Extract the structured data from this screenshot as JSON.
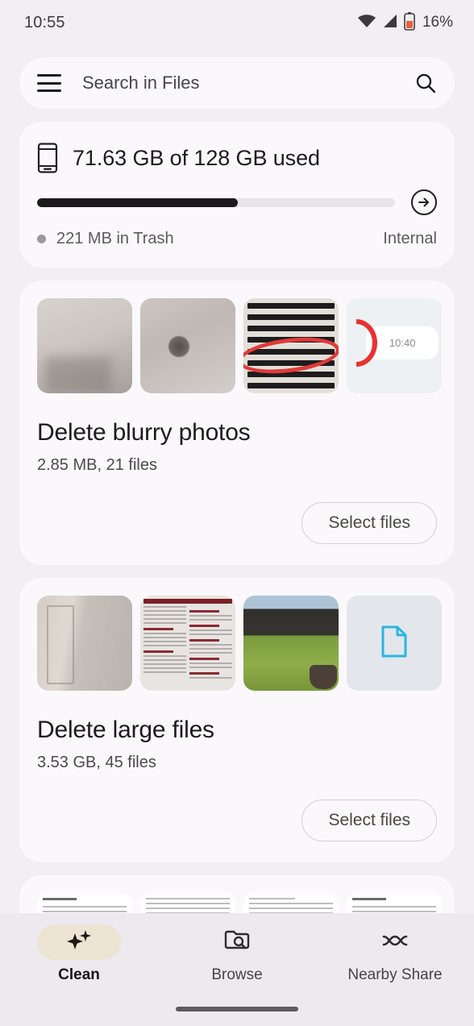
{
  "status_bar": {
    "time": "10:55",
    "battery_percent": "16%",
    "icons": [
      "wifi-icon",
      "cellular-signal-icon",
      "battery-low-icon"
    ]
  },
  "search": {
    "menu_icon": "hamburger-menu-icon",
    "placeholder": "Search in Files",
    "value": "",
    "search_icon": "search-icon"
  },
  "storage": {
    "device_icon": "phone-storage-icon",
    "title": "71.63 GB of 128 GB used",
    "used_gb": 71.63,
    "total_gb": 128,
    "used_percent": 56,
    "trash_label": "221 MB in Trash",
    "location_label": "Internal",
    "arrow_icon": "arrow-forward-circle-icon"
  },
  "suggestions": [
    {
      "id": "delete-blurry-photos",
      "title": "Delete blurry photos",
      "subtitle": "2.85 MB, 21 files",
      "action_label": "Select files",
      "thumbnails": [
        {
          "kind": "photo",
          "art": "art-sink-a",
          "alt": "blurry bathroom surface"
        },
        {
          "kind": "photo",
          "art": "art-sink-b",
          "alt": "blurry sink drain"
        },
        {
          "kind": "photo",
          "art": "art-news",
          "alt": "newspaper clipping with red circle annotation",
          "lines": [
            "ason of mists and",
            "y fruitfulness is",
            "us. For some a sad",
            "ith the daylight",
            "diminishing and",
            "g bills soaring.",
            "r many youngster",
            "ime for excitemen"
          ]
        },
        {
          "kind": "screenshot",
          "art": "art-screenshot",
          "alt": "chat screenshot",
          "badge": "10:40"
        }
      ]
    },
    {
      "id": "delete-large-files",
      "title": "Delete large files",
      "subtitle": "3.53 GB, 45 files",
      "action_label": "Select files",
      "thumbnails": [
        {
          "kind": "photo",
          "art": "art-door",
          "alt": "blurry white door"
        },
        {
          "kind": "document",
          "art": "art-doc-red",
          "alt": "document with red headings"
        },
        {
          "kind": "photo",
          "art": "art-garden",
          "alt": "garden with dark shed"
        },
        {
          "kind": "file",
          "art": "art-generic-file",
          "alt": "generic file",
          "icon": "document-file-icon",
          "icon_color": "#29b6e0"
        }
      ]
    },
    {
      "id": "documents-peek",
      "title": "",
      "subtitle": "",
      "action_label": "",
      "thumbnails": [
        {
          "kind": "document",
          "art": "art-docpage",
          "alt": "text document page"
        },
        {
          "kind": "document",
          "art": "art-docpage",
          "alt": "text document page"
        },
        {
          "kind": "document",
          "art": "art-docpage",
          "alt": "table document page"
        },
        {
          "kind": "document",
          "art": "art-docpage",
          "alt": "spreadsheet page"
        }
      ]
    }
  ],
  "bottom_nav": {
    "items": [
      {
        "id": "clean",
        "label": "Clean",
        "icon": "sparkles-icon",
        "active": true
      },
      {
        "id": "browse",
        "label": "Browse",
        "icon": "folder-search-icon",
        "active": false
      },
      {
        "id": "nearby-share",
        "label": "Nearby Share",
        "icon": "nearby-share-icon",
        "active": false
      }
    ]
  },
  "colors": {
    "background": "#f1eff4",
    "card": "#fbf8fc",
    "nav_background": "#eceaef",
    "active_pill": "#ece3d2",
    "progress_fill": "#1b1b1b",
    "progress_track": "#e7e4ea",
    "file_icon": "#29b6e0",
    "annotation_red": "#e03a3a"
  }
}
